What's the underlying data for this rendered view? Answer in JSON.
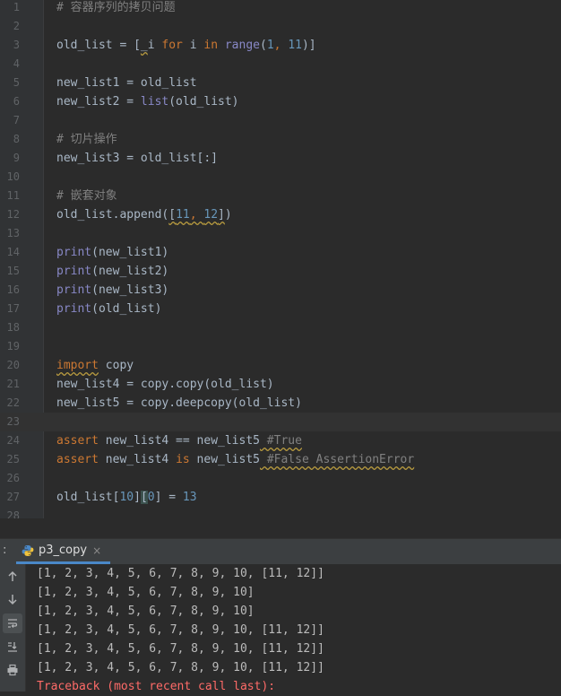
{
  "editor": {
    "current_line": 23,
    "lines": [
      {
        "n": "1",
        "tokens": [
          {
            "t": "# 容器序列的拷贝问题",
            "c": "tok-cmt"
          }
        ]
      },
      {
        "n": "2",
        "tokens": []
      },
      {
        "n": "3",
        "tokens": [
          {
            "t": "old_list = [",
            "c": "tok-plain"
          },
          {
            "t": "_",
            "c": "tok-plain tok-warn"
          },
          {
            "t": "i ",
            "c": "tok-plain"
          },
          {
            "t": "for",
            "c": "tok-kw"
          },
          {
            "t": " i ",
            "c": "tok-plain"
          },
          {
            "t": "in",
            "c": "tok-kw"
          },
          {
            "t": " ",
            "c": "tok-plain"
          },
          {
            "t": "range",
            "c": "tok-builtin"
          },
          {
            "t": "(",
            "c": "tok-plain"
          },
          {
            "t": "1",
            "c": "tok-num"
          },
          {
            "t": ", ",
            "c": "tok-kw"
          },
          {
            "t": "11",
            "c": "tok-num"
          },
          {
            "t": ")]",
            "c": "tok-plain"
          }
        ]
      },
      {
        "n": "4",
        "tokens": []
      },
      {
        "n": "5",
        "tokens": [
          {
            "t": "new_list1 = old_list",
            "c": "tok-plain"
          }
        ]
      },
      {
        "n": "6",
        "tokens": [
          {
            "t": "new_list2 = ",
            "c": "tok-plain"
          },
          {
            "t": "list",
            "c": "tok-builtin"
          },
          {
            "t": "(old_list)",
            "c": "tok-plain"
          }
        ]
      },
      {
        "n": "7",
        "tokens": []
      },
      {
        "n": "8",
        "tokens": [
          {
            "t": "# 切片操作",
            "c": "tok-cmt"
          }
        ]
      },
      {
        "n": "9",
        "tokens": [
          {
            "t": "new_list3 = old_list[:]",
            "c": "tok-plain"
          }
        ]
      },
      {
        "n": "10",
        "tokens": []
      },
      {
        "n": "11",
        "tokens": [
          {
            "t": "# 嵌套对象",
            "c": "tok-cmt"
          }
        ]
      },
      {
        "n": "12",
        "tokens": [
          {
            "t": "old_list.append(",
            "c": "tok-plain"
          },
          {
            "t": "[",
            "c": "tok-plain tok-warn"
          },
          {
            "t": "11",
            "c": "tok-num tok-warn"
          },
          {
            "t": ", ",
            "c": "tok-kw tok-warn"
          },
          {
            "t": "12",
            "c": "tok-num tok-warn"
          },
          {
            "t": "]",
            "c": "tok-plain tok-warn"
          },
          {
            "t": ")",
            "c": "tok-plain"
          }
        ]
      },
      {
        "n": "13",
        "tokens": []
      },
      {
        "n": "14",
        "tokens": [
          {
            "t": "print",
            "c": "tok-builtin"
          },
          {
            "t": "(new_list1)",
            "c": "tok-plain"
          }
        ]
      },
      {
        "n": "15",
        "tokens": [
          {
            "t": "print",
            "c": "tok-builtin"
          },
          {
            "t": "(new_list2)",
            "c": "tok-plain"
          }
        ]
      },
      {
        "n": "16",
        "tokens": [
          {
            "t": "print",
            "c": "tok-builtin"
          },
          {
            "t": "(new_list3)",
            "c": "tok-plain"
          }
        ]
      },
      {
        "n": "17",
        "tokens": [
          {
            "t": "print",
            "c": "tok-builtin"
          },
          {
            "t": "(old_list)",
            "c": "tok-plain"
          }
        ]
      },
      {
        "n": "18",
        "tokens": []
      },
      {
        "n": "19",
        "tokens": []
      },
      {
        "n": "20",
        "tokens": [
          {
            "t": "import",
            "c": "tok-kw tok-warn"
          },
          {
            "t": " copy",
            "c": "tok-plain"
          }
        ]
      },
      {
        "n": "21",
        "tokens": [
          {
            "t": "new_list4 = copy.copy(old_list)",
            "c": "tok-plain"
          }
        ]
      },
      {
        "n": "22",
        "tokens": [
          {
            "t": "new_list5 = copy.deepcopy(old_list)",
            "c": "tok-plain"
          }
        ]
      },
      {
        "n": "23",
        "tokens": []
      },
      {
        "n": "24",
        "tokens": [
          {
            "t": "assert",
            "c": "tok-kw"
          },
          {
            "t": " new_list4 == new_list5",
            "c": "tok-plain"
          },
          {
            "t": " #True",
            "c": "tok-cmt tok-warn"
          }
        ]
      },
      {
        "n": "25",
        "tokens": [
          {
            "t": "assert",
            "c": "tok-kw"
          },
          {
            "t": " new_list4 ",
            "c": "tok-plain"
          },
          {
            "t": "is",
            "c": "tok-kw"
          },
          {
            "t": " new_list5",
            "c": "tok-plain"
          },
          {
            "t": " #False AssertionError",
            "c": "tok-cmt tok-warn"
          }
        ]
      },
      {
        "n": "26",
        "tokens": []
      },
      {
        "n": "27",
        "tokens": [
          {
            "t": "old_list[",
            "c": "tok-plain"
          },
          {
            "t": "10",
            "c": "tok-num"
          },
          {
            "t": "]",
            "c": "tok-plain"
          },
          {
            "t": "[",
            "c": "tok-plain tok-bracket-hl"
          },
          {
            "t": "0",
            "c": "tok-num"
          },
          {
            "t": "] = ",
            "c": "tok-plain"
          },
          {
            "t": "13",
            "c": "tok-num"
          }
        ]
      },
      {
        "n": "28",
        "tokens": []
      }
    ]
  },
  "run_tool": {
    "header_prefix": ":",
    "tab_label": "p3_copy",
    "tab_close": "×",
    "toolbar_icons": [
      "up-arrow-icon",
      "down-arrow-icon",
      "soft-wrap-icon",
      "scroll-to-end-icon",
      "print-icon"
    ],
    "output": [
      {
        "text": "[1, 2, 3, 4, 5, 6, 7, 8, 9, 10, [11, 12]]",
        "error": false
      },
      {
        "text": "[1, 2, 3, 4, 5, 6, 7, 8, 9, 10]",
        "error": false
      },
      {
        "text": "[1, 2, 3, 4, 5, 6, 7, 8, 9, 10]",
        "error": false
      },
      {
        "text": "[1, 2, 3, 4, 5, 6, 7, 8, 9, 10, [11, 12]]",
        "error": false
      },
      {
        "text": "[1, 2, 3, 4, 5, 6, 7, 8, 9, 10, [11, 12]]",
        "error": false
      },
      {
        "text": "[1, 2, 3, 4, 5, 6, 7, 8, 9, 10, [11, 12]]",
        "error": false
      },
      {
        "text": "Traceback (most recent call last):",
        "error": true
      }
    ]
  },
  "colors": {
    "background": "#2b2b2b",
    "keyword": "#cc7832",
    "number": "#6897bb",
    "comment": "#808080",
    "builtin": "#8888c6",
    "error": "#ff6b68",
    "tab_underline": "#4a88c7"
  }
}
